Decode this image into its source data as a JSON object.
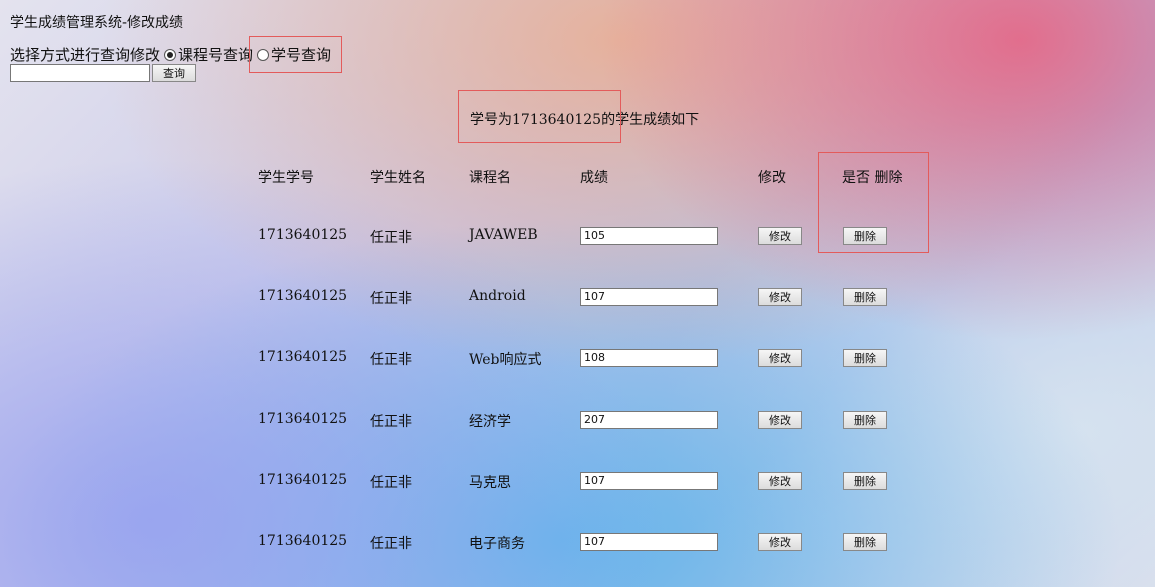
{
  "page_title": "学生成绩管理系统-修改成绩",
  "query": {
    "prompt": "选择方式进行查询修改",
    "option_course": "课程号查询",
    "option_student": "学号查询",
    "selected": "课程号查询",
    "input_value": "",
    "search_label": "查询"
  },
  "result_heading": "学号为1713640125的学生成绩如下",
  "table": {
    "headers": {
      "student_id": "学生学号",
      "student_name": "学生姓名",
      "course": "课程名",
      "score": "成绩",
      "edit": "修改",
      "delete": "是否 删除"
    },
    "rows": [
      {
        "student_id": "1713640125",
        "student_name": "任正非",
        "course": "JAVAWEB",
        "score": "105",
        "edit_label": "修改",
        "delete_label": "删除"
      },
      {
        "student_id": "1713640125",
        "student_name": "任正非",
        "course": "Android",
        "score": "107",
        "edit_label": "修改",
        "delete_label": "删除"
      },
      {
        "student_id": "1713640125",
        "student_name": "任正非",
        "course": "Web响应式",
        "score": "108",
        "edit_label": "修改",
        "delete_label": "删除"
      },
      {
        "student_id": "1713640125",
        "student_name": "任正非",
        "course": "经济学",
        "score": "207",
        "edit_label": "修改",
        "delete_label": "删除"
      },
      {
        "student_id": "1713640125",
        "student_name": "任正非",
        "course": "马克思",
        "score": "107",
        "edit_label": "修改",
        "delete_label": "删除"
      },
      {
        "student_id": "1713640125",
        "student_name": "任正非",
        "course": "电子商务",
        "score": "107",
        "edit_label": "修改",
        "delete_label": "删除"
      }
    ]
  },
  "colors": {
    "annotation_box": "#e35b5b"
  }
}
